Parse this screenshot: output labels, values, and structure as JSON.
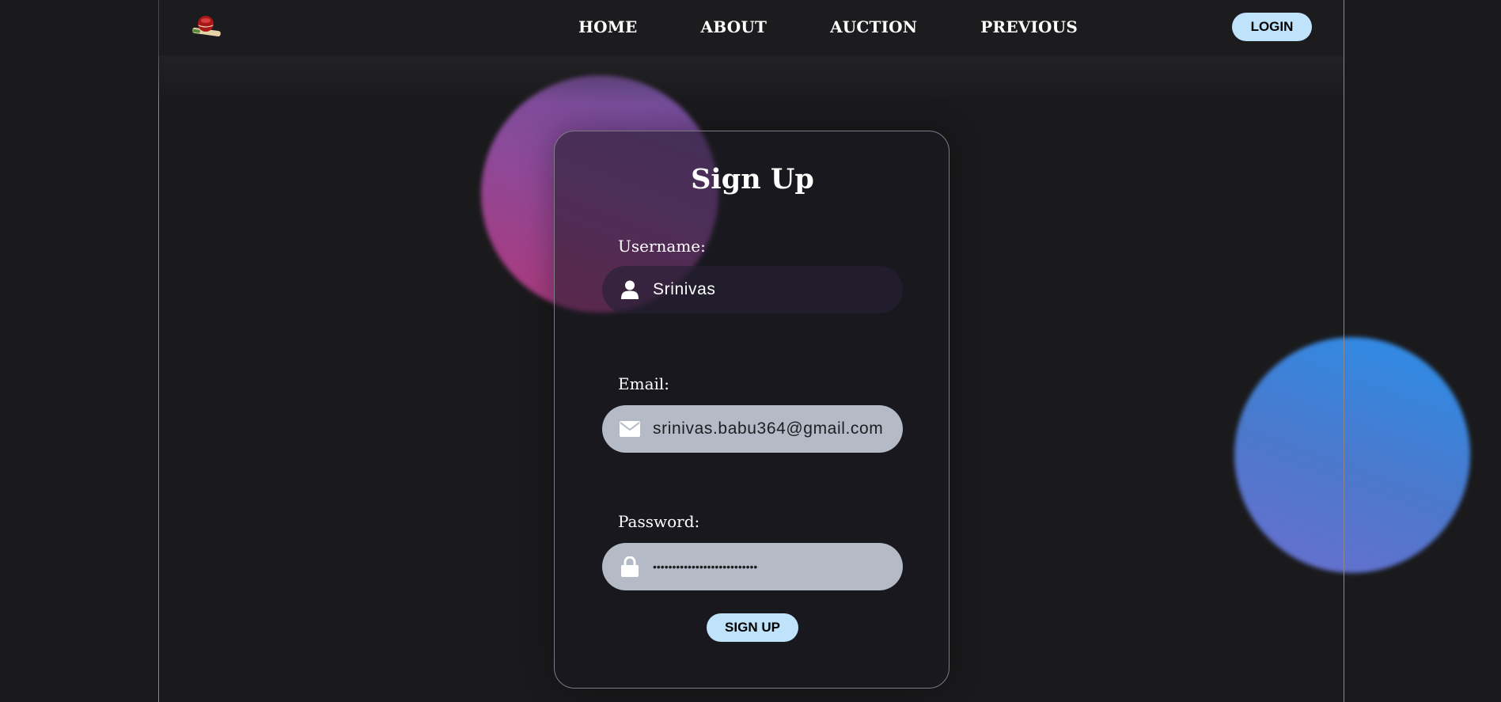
{
  "nav": {
    "logo_icon": "cricket-ball-bat-icon",
    "links": [
      "HOME",
      "ABOUT",
      "AUCTION",
      "PREVIOUS"
    ],
    "login_label": "LOGIN"
  },
  "form": {
    "title": "Sign Up",
    "username": {
      "label": "Username:",
      "value": "Srinivas",
      "icon": "user-icon"
    },
    "email": {
      "label": "Email:",
      "value": "srinivas.babu364@gmail.com",
      "icon": "envelope-icon"
    },
    "password": {
      "label": "Password:",
      "value": "•••••••••••••••••••••••••••",
      "icon": "lock-icon"
    },
    "submit_label": "SIGN UP"
  },
  "colors": {
    "background": "#1a1a1c",
    "button": "#bfe3fb",
    "input_light": "#b4bac6",
    "blob_pink": "#b0387a",
    "blob_blue": "#2b8ee8"
  }
}
